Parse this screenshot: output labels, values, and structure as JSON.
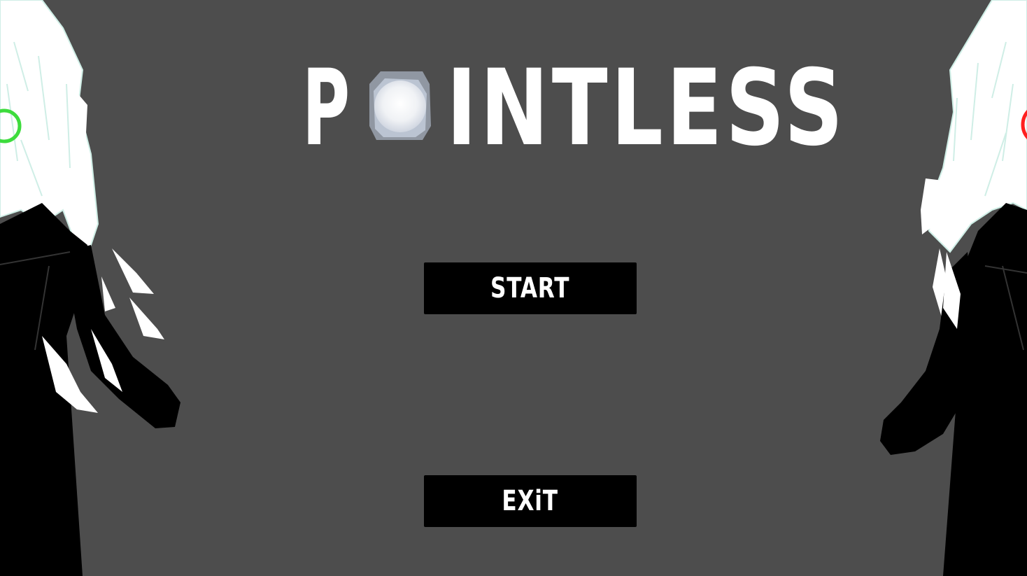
{
  "game": {
    "title_first_letter": "P",
    "title_rest": "INTLESS"
  },
  "menu": {
    "start_label": "START",
    "exit_label": "EXiT"
  },
  "characters": {
    "left": {
      "eye_color": "#3ddc3d"
    },
    "right": {
      "eye_color": "#ff1f1f"
    }
  },
  "colors": {
    "background": "#4d4d4d",
    "button": "#000000",
    "text": "#ffffff"
  }
}
